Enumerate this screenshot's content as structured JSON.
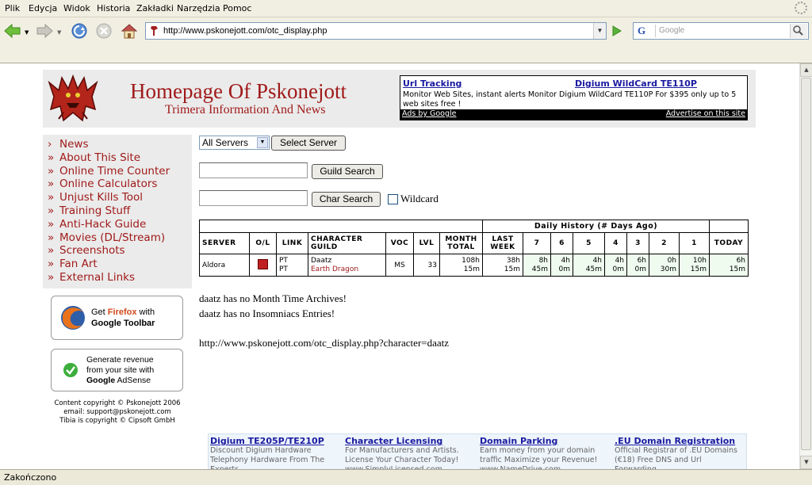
{
  "menu": [
    "Plik",
    "Edycja",
    "Widok",
    "Historia",
    "Zakładki",
    "Narzędzia",
    "Pomoc"
  ],
  "url": "http://www.pskonejott.com/otc_display.php",
  "search_placeholder": "Google",
  "search_engine_glyph": "G",
  "status": "Zakończono",
  "site": {
    "title": "Homepage Of Pskonejott",
    "subtitle": "Trimera Information And News"
  },
  "header_ad": {
    "link1": "Url Tracking",
    "link2": "Digium WildCard TE110P",
    "text": "Monitor Web Sites, instant alerts Monitor Digium WildCard TE110P For $395 only up to 5 web sites free !",
    "footer_left": "Ads by Google",
    "footer_right": "Advertise on this site"
  },
  "sidebar": [
    {
      "arrow": "›",
      "label": "News"
    },
    {
      "arrow": "»",
      "label": "About This Site"
    },
    {
      "arrow": "»",
      "label": "Online Time Counter"
    },
    {
      "arrow": "»",
      "label": "Online Calculators"
    },
    {
      "arrow": "»",
      "label": "Unjust Kills Tool"
    },
    {
      "arrow": "»",
      "label": "Training Stuff"
    },
    {
      "arrow": "»",
      "label": "Anti-Hack Guide"
    },
    {
      "arrow": "»",
      "label": "Movies (DL/Stream)"
    },
    {
      "arrow": "»",
      "label": "Screenshots"
    },
    {
      "arrow": "»",
      "label": "Fan Art"
    },
    {
      "arrow": "»",
      "label": "External Links"
    }
  ],
  "promo_ff": {
    "line1a": "Get ",
    "line1b": "Firefox",
    "line1c": " with",
    "line2": "Google Toolbar"
  },
  "promo_ads": {
    "line1": "Generate revenue",
    "line2": "from your site with",
    "line3a": "Google",
    "line3b": " AdSense"
  },
  "copyright": [
    "Content copyright © Pskonejott 2006",
    "email: support@pskonejott.com",
    "Tibia is copyright © Cipsoft GmbH"
  ],
  "form": {
    "server_value": "All Servers",
    "server_button": "Select Server",
    "guild_button": "Guild Search",
    "char_button": "Char Search",
    "wildcard": "Wildcard"
  },
  "table": {
    "history_header": "Daily History (# Days Ago)",
    "headers": [
      "SERVER",
      "O/L",
      "LINK",
      "CHARACTER GUILD",
      "VOC",
      "LVL",
      "MONTH TOTAL",
      "LAST WEEK",
      "7",
      "6",
      "5",
      "4",
      "3",
      "2",
      "1",
      "TODAY"
    ],
    "row": {
      "server": "Aldora",
      "link1": "PT",
      "link2": "PT",
      "character": "Daatz",
      "guild": "Earth Dragon",
      "voc": "MS",
      "lvl": "33",
      "month_total": [
        "108h",
        "15m"
      ],
      "last_week": [
        "38h",
        "15m"
      ],
      "days": [
        [
          "8h",
          "45m"
        ],
        [
          "4h",
          "0m"
        ],
        [
          "4h",
          "45m"
        ],
        [
          "4h",
          "0m"
        ],
        [
          "6h",
          "0m"
        ],
        [
          "0h",
          "30m"
        ],
        [
          "10h",
          "15m"
        ],
        [
          "6h",
          "15m"
        ]
      ]
    }
  },
  "messages": [
    "daatz has no Month Time Archives!",
    "daatz has no Insomniacs Entries!",
    "http://www.pskonejott.com/otc_display.php?character=daatz"
  ],
  "bottom_ads": [
    {
      "title": "Digium TE205P/TE210P",
      "text": "Discount Digium Hardware Telephony Hardware From The Experts"
    },
    {
      "title": "Character Licensing",
      "text": "For Manufacturers and Artists. License Your Character Today! www.SimplyLicensed.com"
    },
    {
      "title": "Domain Parking",
      "text": "Earn money from your domain traffic Maximize your Revenue! www.NameDrive.com"
    },
    {
      "title": ".EU Domain Registration",
      "text": "Official Registrar of .EU Domains (€18) Free DNS and Url Forwarding"
    }
  ]
}
